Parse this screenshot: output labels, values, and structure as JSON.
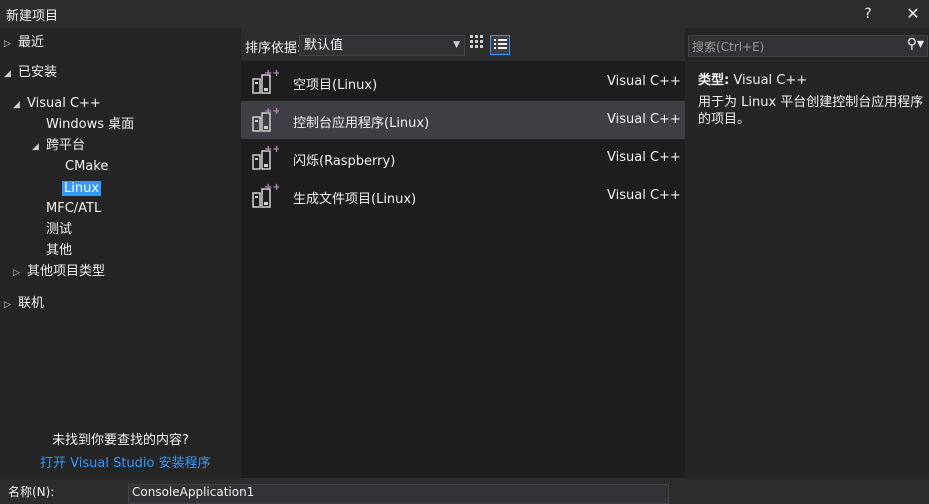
{
  "window": {
    "title": "新建项目",
    "help": "?",
    "close": "✕"
  },
  "tree": {
    "recent": "最近",
    "installed": "已安装",
    "visual_cpp": "Visual C++",
    "windows_desktop": "Windows 桌面",
    "cross_platform": "跨平台",
    "cmake": "CMake",
    "linux": "Linux",
    "mfc_atl": "MFC/ATL",
    "test": "测试",
    "other": "其他",
    "other_project_types": "其他项目类型",
    "online": "联机"
  },
  "not_found": {
    "question": "未找到你要查找的内容?",
    "link": "打开 Visual Studio 安装程序"
  },
  "sort": {
    "label": "排序依据:",
    "value": "默认值"
  },
  "templates": [
    {
      "name": "空项目(Linux)",
      "lang": "Visual C++"
    },
    {
      "name": "控制台应用程序(Linux)",
      "lang": "Visual C++"
    },
    {
      "name": "闪烁(Raspberry)",
      "lang": "Visual C++"
    },
    {
      "name": "生成文件项目(Linux)",
      "lang": "Visual C++"
    }
  ],
  "search": {
    "placeholder": "搜索(Ctrl+E)"
  },
  "details": {
    "type_label": "类型:",
    "type_value": "Visual C++",
    "description": "用于为 Linux 平台创建控制台应用程序的项目。"
  },
  "bottom": {
    "name_label": "名称(N):",
    "name_value": "ConsoleApplication1"
  },
  "colors": {
    "accent": "#3399ff",
    "background": "#2d2d30",
    "list": "#1e1e1e",
    "selected_row": "#3f3f46"
  }
}
